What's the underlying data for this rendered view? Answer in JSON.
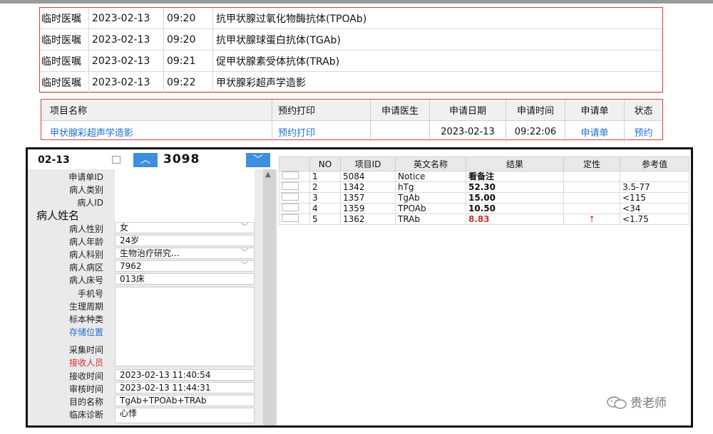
{
  "orders": [
    {
      "type": "临时医嘱",
      "date": "2023-02-13",
      "time": "09:20",
      "item": "抗甲状腺过氧化物酶抗体(TPOAb)"
    },
    {
      "type": "临时医嘱",
      "date": "2023-02-13",
      "time": "09:20",
      "item": "抗甲状腺球蛋白抗体(TGAb)"
    },
    {
      "type": "临时医嘱",
      "date": "2023-02-13",
      "time": "09:21",
      "item": "促甲状腺素受体抗体(TRAb)"
    },
    {
      "type": "临时医嘱",
      "date": "2023-02-13",
      "time": "09:22",
      "item": "甲状腺彩超声学造影"
    }
  ],
  "appointment": {
    "headers": [
      "项目名称",
      "预约打印",
      "申请医生",
      "申请日期",
      "申请时间",
      "申请单",
      "状态"
    ],
    "row": {
      "item": "甲状腺彩超声学造影",
      "print": "预约打印",
      "doctor": "",
      "date": "2023-02-13",
      "time": "09:22:06",
      "form": "申请单",
      "status": "预约"
    }
  },
  "lis": {
    "date": "02-13",
    "sample_no": "3098",
    "up_label": "︿",
    "down_label": "﹀",
    "labels": {
      "request_id": "申请单ID",
      "patient_type": "病人类别",
      "patient_id": "病人ID",
      "patient_name": "病人姓名",
      "gender": "病人性别",
      "age": "病人年龄",
      "dept": "病人科别",
      "ward": "病人病区",
      "bed": "病人床号",
      "phone": "手机号",
      "cycle": "生理周期",
      "specimen": "标本种类",
      "storage": "存储位置",
      "collect_time": "采集时间",
      "receiver": "接收人员",
      "receive_time": "接收时间",
      "audit_time": "审核时间",
      "purpose": "目的名称",
      "diagnosis": "临床诊断"
    },
    "values": {
      "gender": "女",
      "age": "24岁",
      "dept": "生物治疗研究...",
      "ward": "7962",
      "bed": "013床",
      "receive_time": "2023-02-13 11:40:54",
      "audit_time": "2023-02-13 11:44:31",
      "purpose": "TgAb+TPOAb+TRAb",
      "diagnosis": "心悸"
    },
    "results_headers": [
      "NO",
      "项目ID",
      "英文名称",
      "结果",
      "定性",
      "参考值"
    ],
    "results": [
      {
        "no": "1",
        "id": "5084",
        "name": "Notice",
        "result": "看备注",
        "flag": "",
        "ref": ""
      },
      {
        "no": "2",
        "id": "1342",
        "name": "hTg",
        "result": "52.30",
        "flag": "",
        "ref": "3.5-77"
      },
      {
        "no": "3",
        "id": "1357",
        "name": "TgAb",
        "result": "15.00",
        "flag": "",
        "ref": "<115"
      },
      {
        "no": "4",
        "id": "1359",
        "name": "TPOAb",
        "result": "10.50",
        "flag": "",
        "ref": "<34"
      },
      {
        "no": "5",
        "id": "1362",
        "name": "TRAb",
        "result": "8.83",
        "flag": "↑",
        "ref": "<1.75"
      }
    ]
  },
  "watermark": "贵老师",
  "colors": {
    "accent_red": "#e23a3a",
    "link_blue": "#1f6fd1",
    "button_blue": "#3d8fe0",
    "abnormal_red": "#d23030"
  }
}
